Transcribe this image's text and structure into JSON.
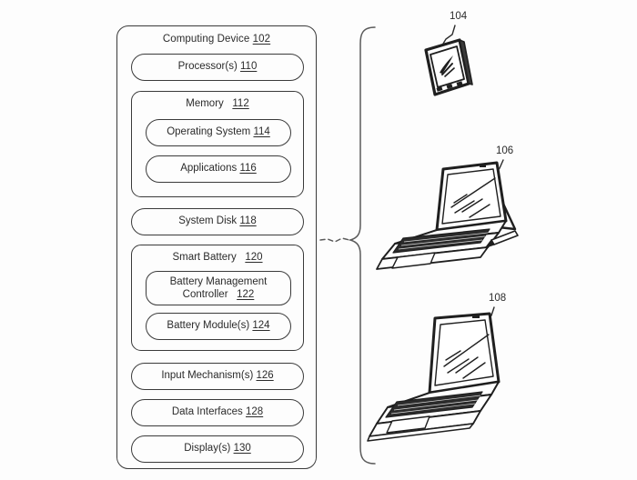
{
  "figure": {
    "background_color": "#fdfdfd",
    "line_color": "#3a3a3a",
    "text_color": "#2b2b2b"
  },
  "block_diagram": {
    "title_text": "Computing Device",
    "title_ref": "102",
    "processor": {
      "label": "Processor(s)",
      "ref": "110"
    },
    "memory": {
      "label": "Memory",
      "ref": "112",
      "children": [
        {
          "label": "Operating System",
          "ref": "114"
        },
        {
          "label": "Applications",
          "ref": "116"
        }
      ]
    },
    "system_disk": {
      "label": "System Disk",
      "ref": "118"
    },
    "smart_battery": {
      "label": "Smart Battery",
      "ref": "120",
      "children": [
        {
          "label_line1": "Battery Management",
          "label_line2": "Controller",
          "ref": "122"
        },
        {
          "label": "Battery Module(s)",
          "ref": "124"
        }
      ]
    },
    "input_mechanisms": {
      "label": "Input Mechanism(s)",
      "ref": "126"
    },
    "data_interfaces": {
      "label": "Data Interfaces",
      "ref": "128"
    },
    "displays": {
      "label": "Display(s)",
      "ref": "130"
    }
  },
  "devices": {
    "brace_note": "curly brace grouping the example devices, joined to block diagram by a dashed leader",
    "items": [
      {
        "name": "smartphone",
        "ref": "104"
      },
      {
        "name": "detachable-tablet-with-keyboard-and-stylus",
        "ref": "106"
      },
      {
        "name": "laptop",
        "ref": "108"
      }
    ]
  }
}
